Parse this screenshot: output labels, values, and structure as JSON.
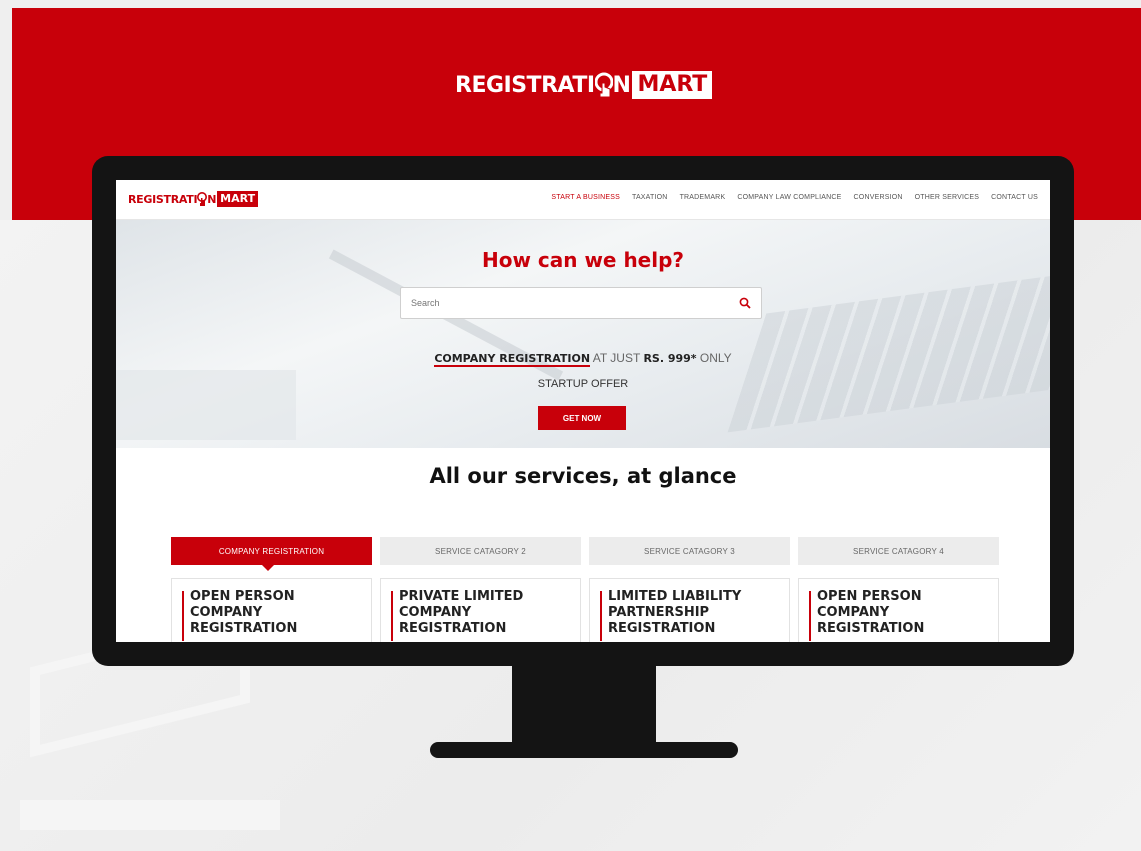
{
  "banner": {
    "logo_word": "REGISTRATI",
    "logo_suffix": "N",
    "logo_badge": "MART"
  },
  "site": {
    "logo_word": "REGISTRATI",
    "logo_suffix": "N",
    "logo_badge": "MART",
    "nav": [
      "START A BUSINESS",
      "TAXATION",
      "TRADEMARK",
      "COMPANY LAW COMPLIANCE",
      "CONVERSION",
      "OTHER SERVICES",
      "CONTACT US"
    ]
  },
  "hero": {
    "title": "How can we help?",
    "search_placeholder": "Search",
    "offer_bold": "COMPANY REGISTRATION",
    "offer_mid": " AT JUST ",
    "offer_price": "RS. 999*",
    "offer_end": " ONLY",
    "offer_sub": "STARTUP OFFER",
    "cta": "GET NOW"
  },
  "services": {
    "title": "All our services, at glance",
    "tabs": [
      "COMPANY REGISTRATION",
      "SERVICE CATAGORY 2",
      "SERVICE CATAGORY 3",
      "SERVICE CATAGORY 4"
    ],
    "cards": [
      [
        "OPEN PERSON",
        "COMPANY",
        "REGISTRATION"
      ],
      [
        "PRIVATE LIMITED",
        "COMPANY",
        "REGISTRATION"
      ],
      [
        "LIMITED LIABILITY",
        "PARTNERSHIP",
        "REGISTRATION"
      ],
      [
        "OPEN PERSON",
        "COMPANY",
        "REGISTRATION"
      ]
    ]
  },
  "colors": {
    "brand_red": "#c8000a",
    "monitor": "#141414"
  }
}
